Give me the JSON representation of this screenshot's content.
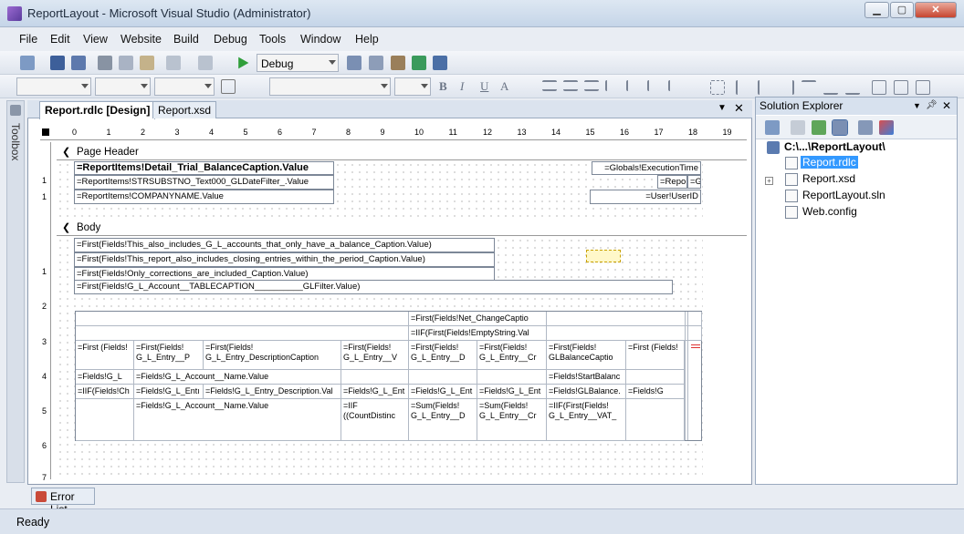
{
  "window": {
    "title": "ReportLayout - Microsoft Visual Studio (Administrator)",
    "minimize": "▁",
    "maximize": "▢",
    "close": "✕"
  },
  "menu": [
    "File",
    "Edit",
    "View",
    "Website",
    "Build",
    "Debug",
    "Tools",
    "Window",
    "Help"
  ],
  "toolbar": {
    "config": "Debug"
  },
  "format_toolbar": {
    "bold": "B",
    "italic": "I",
    "underline": "U",
    "font_color": "A"
  },
  "toolbox": {
    "label": "Toolbox"
  },
  "tabs": [
    {
      "label": "Report.rdlc [Design]"
    },
    {
      "label": "Report.xsd"
    }
  ],
  "ruler": {
    "marks": [
      "0",
      "1",
      "2",
      "3",
      "4",
      "5",
      "6",
      "7",
      "8",
      "9",
      "10",
      "11",
      "12",
      "13",
      "14",
      "15",
      "16",
      "17",
      "18",
      "19"
    ]
  },
  "vruler": {
    "header": [
      "1",
      "1"
    ],
    "body": [
      "1",
      "2",
      "3",
      "4",
      "5",
      "6",
      "7"
    ]
  },
  "page_header": {
    "label": "Page Header",
    "caption": "=ReportItems!Detail_Trial_BalanceCaption.Value",
    "filter": "=ReportItems!STRSUBSTNO_Text000_GLDateFilter_.Value",
    "company": "=ReportItems!COMPANYNAME.Value",
    "exec_time": "=Globals!ExecutionTime",
    "repo": "=Repo",
    "gl": "=Gl",
    "user": "=User!UserID"
  },
  "body": {
    "label": "Body",
    "notes": [
      "=First(Fields!This_also_includes_G_L_accounts_that_only_have_a_balance_Caption.Value)",
      "=First(Fields!This_report_also_includes_closing_entries_within_the_period_Caption.Value)",
      "=First(Fields!Only_corrections_are_included_Caption.Value)",
      "=First(Fields!G_L_Account__TABLECAPTION__________GLFilter.Value)"
    ],
    "grid_top": [
      "=First(Fields!Net_ChangeCaptio",
      "=IIF(First(Fields!EmptyString.Val"
    ],
    "grid_headers": [
      "=First (Fields!",
      "=First(Fields! G_L_Entry__P",
      "=First(Fields! G_L_Entry_DescriptionCaption",
      "=First(Fields! G_L_Entry__V",
      "=First(Fields! G_L_Entry__D",
      "=First(Fields! G_L_Entry__Cr",
      "=First(Fields! GLBalanceCaptio",
      "=First (Fields!"
    ],
    "row1": [
      "=Fields!G_L",
      "=Fields!G_L_Account__Name.Value",
      "",
      "",
      "",
      "",
      "=Fields!StartBalanc",
      ""
    ],
    "row2": [
      "=IIF(Fields!Ch",
      "=Fields!G_L_Entı",
      "=Fields!G_L_Entry_Description.Val",
      "=Fields!G_L_Ent",
      "=Fields!G_L_Ent",
      "=Fields!G_L_Ent",
      "=Fields!GLBalance.",
      "=Fields!G"
    ],
    "row3": [
      "",
      "=Fields!G_L_Account__Name.Value",
      "",
      "=IIF ((CountDistinc",
      "=Sum(Fields! G_L_Entry__D",
      "=Sum(Fields! G_L_Entry__Cr",
      "=IIF(First(Fields! G_L_Entry__VAT_",
      ""
    ]
  },
  "solution_explorer": {
    "title": "Solution Explorer",
    "root": "C:\\...\\ReportLayout\\",
    "items": [
      "Report.rdlc",
      "Report.xsd",
      "ReportLayout.sln",
      "Web.config"
    ]
  },
  "error_list": "Error List",
  "status": "Ready"
}
